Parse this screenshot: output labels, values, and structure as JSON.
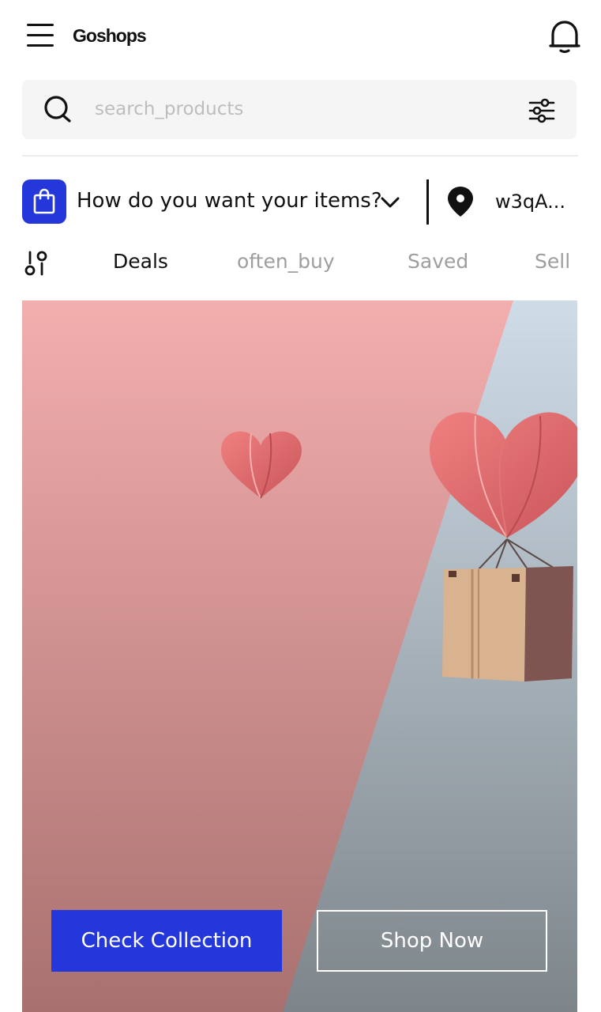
{
  "header": {
    "brand": "Goshops",
    "menu_icon": "hamburger-menu-icon",
    "notification_icon": "bell-icon"
  },
  "search": {
    "placeholder": "search_products",
    "value": "",
    "search_icon": "search-icon",
    "filter_icon": "sliders-icon"
  },
  "delivery": {
    "bag_icon": "shopping-bag-icon",
    "prompt": "How do you want your items?",
    "dropdown_icon": "chevron-down-icon",
    "location_icon": "map-pin-icon",
    "address": "w3qA..."
  },
  "tabs": {
    "filter_icon": "sort-filter-icon",
    "items": [
      {
        "label": "Deals",
        "active": true
      },
      {
        "label": "often_buy",
        "active": false
      },
      {
        "label": "Saved",
        "active": false
      },
      {
        "label": "Sell",
        "active": false
      }
    ]
  },
  "banner": {
    "primary_button": "Check Collection",
    "secondary_button": "Shop Now"
  },
  "colors": {
    "accent": "#2437db",
    "banner_pink_top": "#f3aeae",
    "banner_pink_bottom": "#a8716f",
    "banner_blue_top": "#cfdce8",
    "banner_blue_bottom": "#7d858a"
  }
}
